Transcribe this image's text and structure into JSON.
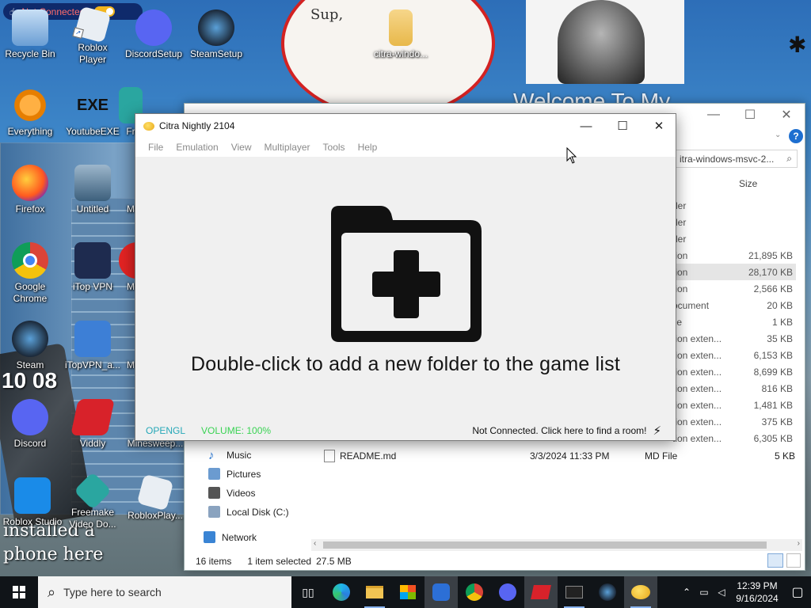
{
  "vpn_pill": {
    "label": "Not Connected!"
  },
  "desktop": {
    "wallpaper_text": {
      "welcome": "Welcome To My",
      "installed": "installed a",
      "phone": "phone here",
      "clock_art": "10 08",
      "sup": "Sup,"
    },
    "icons": [
      {
        "label": "Recycle Bin"
      },
      {
        "label": "Roblox Player"
      },
      {
        "label": "DiscordSetup"
      },
      {
        "label": "SteamSetup"
      },
      {
        "label": "citra-windo..."
      },
      {
        "label": "Everything"
      },
      {
        "label": "YoutubeEXE",
        "glyph": "EXE"
      },
      {
        "label": "Fr"
      },
      {
        "label": "Firefox"
      },
      {
        "label": "Untitled"
      },
      {
        "label": "M"
      },
      {
        "label": "Google Chrome"
      },
      {
        "label": "iTop VPN"
      },
      {
        "label": "M"
      },
      {
        "label": "Steam"
      },
      {
        "label": "iTopVPN_a..."
      },
      {
        "label": "M"
      },
      {
        "label": "Discord"
      },
      {
        "label": "Viddly"
      },
      {
        "label": "Minesweep..."
      },
      {
        "label": "Roblox Studio"
      },
      {
        "label": "Freemake Video Do..."
      },
      {
        "label": "RobloxPlay..."
      }
    ]
  },
  "explorer": {
    "controls": {
      "minimize": "—",
      "maximize": "☐",
      "close": "✕"
    },
    "search_value": "itra-windows-msvc-2...",
    "size_header": "Size",
    "partial_rows": [
      {
        "type": "der",
        "size": ""
      },
      {
        "type": "der",
        "size": ""
      },
      {
        "type": "der",
        "size": ""
      },
      {
        "type": "tion",
        "size": "21,895 KB"
      },
      {
        "type": "tion",
        "size": "28,170 KB",
        "selected": true
      },
      {
        "type": "tion",
        "size": "2,566 KB"
      },
      {
        "type": "ocument",
        "size": "20 KB"
      },
      {
        "type": "ile",
        "size": "1 KB"
      },
      {
        "type": "tion exten...",
        "size": "35 KB"
      },
      {
        "type": "tion exten...",
        "size": "6,153 KB"
      },
      {
        "type": "tion exten...",
        "size": "8,699 KB"
      },
      {
        "type": "tion exten...",
        "size": "816 KB"
      },
      {
        "type": "tion exten...",
        "size": "1,481 KB"
      },
      {
        "type": "tion exten...",
        "size": "375 KB"
      },
      {
        "type": "tion exten...",
        "size": "6,305 KB"
      }
    ],
    "nav": [
      {
        "label": "Music",
        "color": "#1e6fd0"
      },
      {
        "label": "Pictures",
        "color": "#6b9bd0"
      },
      {
        "label": "Videos",
        "color": "#555"
      },
      {
        "label": "Local Disk (C:)",
        "color": "#8aa3bf"
      },
      {
        "label": "Network",
        "color": "#3a84d4"
      }
    ],
    "file": {
      "name": "README.md",
      "date": "3/3/2024 11:33 PM",
      "type": "MD File",
      "size": "5 KB"
    },
    "status": {
      "items": "16 items",
      "selected": "1 item selected",
      "size": "27.5 MB"
    }
  },
  "citra": {
    "title": "Citra Nightly 2104",
    "controls": {
      "minimize": "—",
      "maximize": "☐",
      "close": "✕"
    },
    "menu": [
      "File",
      "Emulation",
      "View",
      "Multiplayer",
      "Tools",
      "Help"
    ],
    "message": "Double-click to add a new folder to the game list",
    "status": {
      "renderer": "OPENGL",
      "volume": "VOLUME: 100%",
      "network": "Not Connected. Click here to find a room!"
    },
    "colors": {
      "renderer": "#26a8b8",
      "volume": "#39d353"
    }
  },
  "taskbar": {
    "search_placeholder": "Type here to search",
    "time": "12:39 PM",
    "date": "9/16/2024"
  }
}
